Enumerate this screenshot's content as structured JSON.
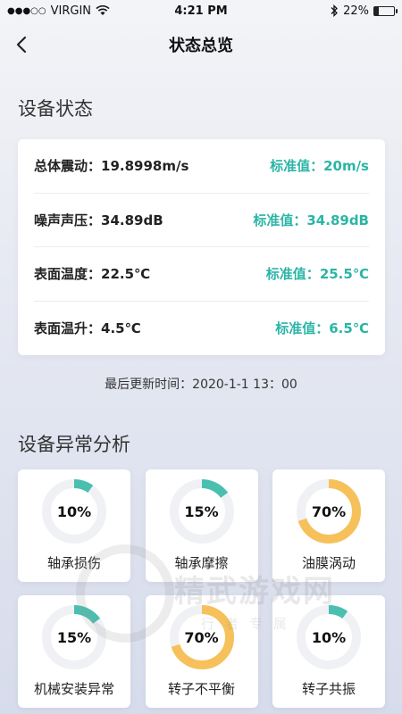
{
  "status_bar": {
    "carrier": "VIRGIN",
    "time": "4:21 PM",
    "battery": "22%",
    "battery_level": 0.22,
    "icons": [
      "signal-dots-icon",
      "wifi-icon",
      "bluetooth-icon",
      "battery-icon"
    ]
  },
  "nav": {
    "title": "状态总览",
    "back_icon": "back-chevron-icon"
  },
  "device_status": {
    "title": "设备状态",
    "rows": [
      {
        "label": "总体震动：",
        "value": "19.8998m/s",
        "std_label": "标准值：",
        "std_value": "20m/s"
      },
      {
        "label": "噪声声压：",
        "value": "34.89dB",
        "std_label": "标准值：",
        "std_value": "34.89dB"
      },
      {
        "label": "表面温度：",
        "value": "22.5℃",
        "std_label": "标准值：",
        "std_value": "25.5℃"
      },
      {
        "label": "表面温升：",
        "value": "4.5℃",
        "std_label": "标准值：",
        "std_value": "6.5℃"
      }
    ],
    "updated": "最后更新时间：2020-1-1  13：00"
  },
  "analysis": {
    "title": "设备异常分析",
    "items": [
      {
        "label": "轴承损伤",
        "percent": "10%",
        "level": 0.1,
        "color": "#49bfb0"
      },
      {
        "label": "轴承摩擦",
        "percent": "15%",
        "level": 0.15,
        "color": "#49bfb0"
      },
      {
        "label": "油膜涡动",
        "percent": "70%",
        "level": 0.7,
        "color": "#f6c15a"
      },
      {
        "label": "机械安装异常",
        "percent": "15%",
        "level": 0.15,
        "color": "#49bfb0"
      },
      {
        "label": "转子不平衡",
        "percent": "70%",
        "level": 0.7,
        "color": "#f6c15a"
      },
      {
        "label": "转子共振",
        "percent": "10%",
        "level": 0.1,
        "color": "#49bfb0"
      }
    ]
  },
  "colors": {
    "accent": "#2bb5a6",
    "track": "#f0f1f4",
    "warning": "#f6c15a"
  }
}
